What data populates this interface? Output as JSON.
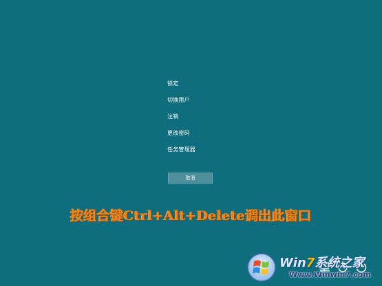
{
  "menu": {
    "items": [
      {
        "label": "锁定"
      },
      {
        "label": "切换用户"
      },
      {
        "label": "注销"
      },
      {
        "label": "更改密码"
      },
      {
        "label": "任务管理器"
      }
    ],
    "cancel_label": "取消"
  },
  "caption": "按组合键Ctrl+Alt+Delete调出此窗口",
  "tray": {
    "icons": [
      "network-icon",
      "accessibility-icon",
      "power-icon"
    ]
  },
  "watermark": {
    "title_prefix": "Win",
    "title_highlight": "7",
    "title_suffix": "系统之家",
    "url": "Www.Winwin7.com"
  },
  "colors": {
    "background": "#0e6e7e",
    "caption": "#e8851c",
    "button": "#4d8f9b"
  }
}
